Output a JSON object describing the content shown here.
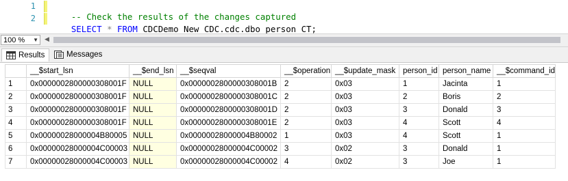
{
  "editor": {
    "line_numbers": [
      "1",
      "2"
    ],
    "line1_comment": "-- Check the results of the changes captured",
    "line2": {
      "select": "SELECT",
      "star": "*",
      "from": "FROM",
      "object": "CDCDemo_New_CDC.cdc.dbo_person_CT;"
    }
  },
  "zoom": {
    "value": "100 %"
  },
  "tabs": {
    "results": "Results",
    "messages": "Messages"
  },
  "grid": {
    "columns": [
      "__$start_lsn",
      "__$end_lsn",
      "__$seqval",
      "__$operation",
      "__$update_mask",
      "person_id",
      "person_name",
      "__$command_id"
    ],
    "rows": [
      [
        "1",
        "0x0000002800000308001F",
        "NULL",
        "0x0000002800000308001B",
        "2",
        "0x03",
        "1",
        "Jacinta",
        "1"
      ],
      [
        "2",
        "0x0000002800000308001F",
        "NULL",
        "0x0000002800000308001C",
        "2",
        "0x03",
        "2",
        "Boris",
        "2"
      ],
      [
        "3",
        "0x0000002800000308001F",
        "NULL",
        "0x0000002800000308001D",
        "2",
        "0x03",
        "3",
        "Donald",
        "3"
      ],
      [
        "4",
        "0x0000002800000308001F",
        "NULL",
        "0x0000002800000308001E",
        "2",
        "0x03",
        "4",
        "Scott",
        "4"
      ],
      [
        "5",
        "0x00000028000004B80005",
        "NULL",
        "0x00000028000004B80002",
        "1",
        "0x03",
        "4",
        "Scott",
        "1"
      ],
      [
        "6",
        "0x00000028000004C00003",
        "NULL",
        "0x00000028000004C00002",
        "3",
        "0x02",
        "3",
        "Donald",
        "1"
      ],
      [
        "7",
        "0x00000028000004C00003",
        "NULL",
        "0x00000028000004C00002",
        "4",
        "0x02",
        "3",
        "Joe",
        "1"
      ]
    ]
  }
}
